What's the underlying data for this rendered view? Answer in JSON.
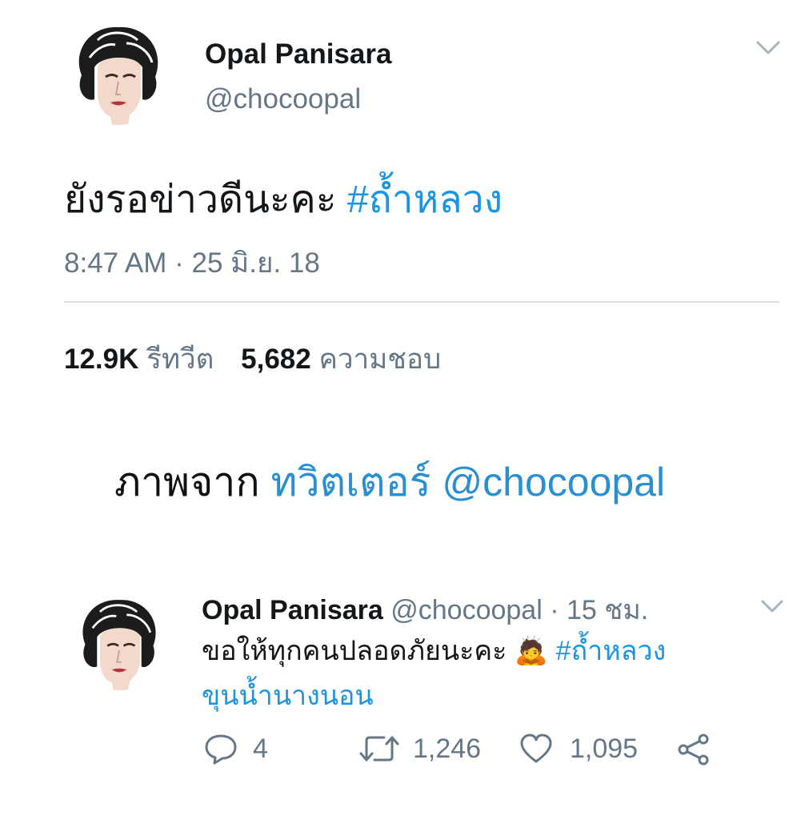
{
  "tweet1": {
    "name": "Opal Panisara",
    "handle": "@chocoopal",
    "text": "ยังรอข่าวดีนะคะ",
    "hashtag": "#ถ้ำหลวง",
    "timestamp": "8:47 AM · 25 มิ.ย. 18",
    "retweets_count": "12.9K",
    "retweets_label": "รีทวีต",
    "likes_count": "5,682",
    "likes_label": "ความชอบ"
  },
  "caption": {
    "prefix": "ภาพจาก",
    "source": "ทวิตเตอร์ @chocoopal"
  },
  "tweet2": {
    "name": "Opal Panisara",
    "handle": "@chocoopal",
    "time": "· 15 ชม.",
    "text": "ขอให้ทุกคนปลอดภัยนะคะ",
    "emoji": "🙇",
    "hashtag1": "#ถ้ำหลวง",
    "hashtag2": "ขุนน้ำนางนอน",
    "replies": "4",
    "retweets": "1,246",
    "likes": "1,095"
  },
  "colors": {
    "link": "#1b95e0",
    "muted": "#657786",
    "text": "#14171a"
  }
}
